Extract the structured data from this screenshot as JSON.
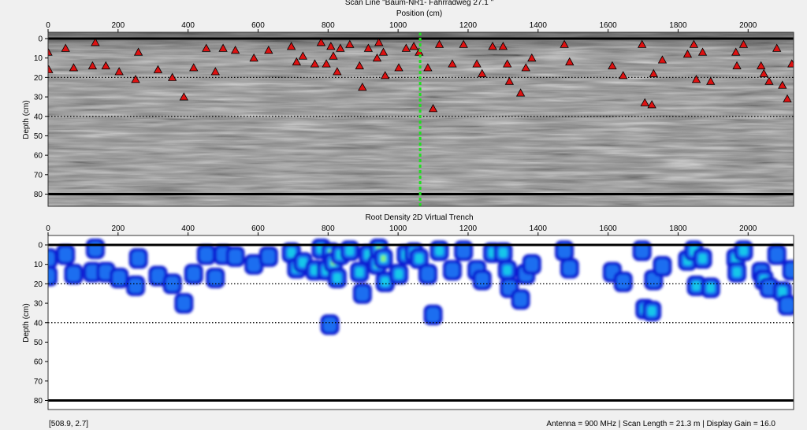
{
  "top_title_line1": "Scan Line \"Baum-NR1- Fahrradweg 27.1 \"",
  "status": {
    "coords": "[508.9, 2.7]",
    "info": "Antenna = 900 MHz | Scan Length = 21.3 m | Display Gain = 16.0"
  },
  "colors": {
    "background": "#f0f0f0",
    "marker_fill": "#dd1111",
    "cursor_line": "#22dd22",
    "depth_line": "#000000"
  },
  "chart_data": [
    {
      "type": "scatter",
      "title": "Position (cm)",
      "xlabel": "",
      "ylabel": "Depth (cm)",
      "xlim": [
        0,
        2130
      ],
      "ylim": [
        0,
        85
      ],
      "y_inverted": true,
      "x_axis_position": "top",
      "x_ticks": [
        0,
        200,
        400,
        600,
        800,
        1000,
        1200,
        1400,
        1600,
        1800,
        2000
      ],
      "y_ticks": [
        0,
        10,
        20,
        30,
        40,
        50,
        60,
        70,
        80
      ],
      "background": "greyscale radargram",
      "reference_lines": {
        "dotted_depths": [
          20,
          40
        ],
        "solid_depths": [
          0,
          80
        ]
      },
      "cursor_position": 1063,
      "marker": "red triangle",
      "points": [
        {
          "x": 0,
          "y": 7
        },
        {
          "x": 2,
          "y": 16
        },
        {
          "x": 50,
          "y": 5
        },
        {
          "x": 73,
          "y": 15
        },
        {
          "x": 127,
          "y": 14
        },
        {
          "x": 135,
          "y": 2
        },
        {
          "x": 165,
          "y": 14
        },
        {
          "x": 203,
          "y": 17
        },
        {
          "x": 250,
          "y": 21
        },
        {
          "x": 258,
          "y": 7
        },
        {
          "x": 314,
          "y": 16
        },
        {
          "x": 355,
          "y": 20
        },
        {
          "x": 388,
          "y": 30
        },
        {
          "x": 416,
          "y": 15
        },
        {
          "x": 452,
          "y": 5
        },
        {
          "x": 478,
          "y": 17
        },
        {
          "x": 500,
          "y": 5
        },
        {
          "x": 535,
          "y": 6
        },
        {
          "x": 588,
          "y": 10
        },
        {
          "x": 630,
          "y": 6
        },
        {
          "x": 695,
          "y": 4
        },
        {
          "x": 710,
          "y": 12
        },
        {
          "x": 728,
          "y": 9
        },
        {
          "x": 762,
          "y": 13
        },
        {
          "x": 780,
          "y": 2
        },
        {
          "x": 795,
          "y": 13
        },
        {
          "x": 808,
          "y": 4
        },
        {
          "x": 815,
          "y": 9
        },
        {
          "x": 826,
          "y": 17
        },
        {
          "x": 835,
          "y": 5
        },
        {
          "x": 862,
          "y": 3
        },
        {
          "x": 890,
          "y": 14
        },
        {
          "x": 898,
          "y": 25
        },
        {
          "x": 915,
          "y": 5
        },
        {
          "x": 940,
          "y": 10
        },
        {
          "x": 945,
          "y": 2
        },
        {
          "x": 958,
          "y": 7
        },
        {
          "x": 963,
          "y": 19
        },
        {
          "x": 1002,
          "y": 15
        },
        {
          "x": 1023,
          "y": 5
        },
        {
          "x": 1045,
          "y": 4
        },
        {
          "x": 1060,
          "y": 7
        },
        {
          "x": 1085,
          "y": 15
        },
        {
          "x": 1100,
          "y": 36
        },
        {
          "x": 1118,
          "y": 3
        },
        {
          "x": 1155,
          "y": 13
        },
        {
          "x": 1187,
          "y": 3
        },
        {
          "x": 1225,
          "y": 13
        },
        {
          "x": 1240,
          "y": 18
        },
        {
          "x": 1270,
          "y": 4
        },
        {
          "x": 1300,
          "y": 4
        },
        {
          "x": 1312,
          "y": 13
        },
        {
          "x": 1318,
          "y": 22
        },
        {
          "x": 1350,
          "y": 28
        },
        {
          "x": 1365,
          "y": 15
        },
        {
          "x": 1382,
          "y": 10
        },
        {
          "x": 1475,
          "y": 3
        },
        {
          "x": 1490,
          "y": 12
        },
        {
          "x": 1612,
          "y": 14
        },
        {
          "x": 1643,
          "y": 19
        },
        {
          "x": 1697,
          "y": 3
        },
        {
          "x": 1705,
          "y": 33
        },
        {
          "x": 1725,
          "y": 34
        },
        {
          "x": 1730,
          "y": 18
        },
        {
          "x": 1755,
          "y": 11
        },
        {
          "x": 1827,
          "y": 8
        },
        {
          "x": 1845,
          "y": 3
        },
        {
          "x": 1852,
          "y": 21
        },
        {
          "x": 1870,
          "y": 7
        },
        {
          "x": 1893,
          "y": 22
        },
        {
          "x": 1965,
          "y": 7
        },
        {
          "x": 1968,
          "y": 14
        },
        {
          "x": 1987,
          "y": 3
        },
        {
          "x": 2037,
          "y": 14
        },
        {
          "x": 2045,
          "y": 18
        },
        {
          "x": 2060,
          "y": 22
        },
        {
          "x": 2082,
          "y": 5
        },
        {
          "x": 2098,
          "y": 24
        },
        {
          "x": 2112,
          "y": 31
        },
        {
          "x": 2125,
          "y": 13
        }
      ]
    },
    {
      "type": "heatmap",
      "title": "Root Density 2D Virtual Trench",
      "xlabel": "",
      "ylabel": "Depth (cm)",
      "xlim": [
        0,
        2130
      ],
      "ylim": [
        0,
        85
      ],
      "y_inverted": true,
      "x_axis_position": "top",
      "x_ticks": [
        0,
        200,
        400,
        600,
        800,
        1000,
        1200,
        1400,
        1600,
        1800,
        2000
      ],
      "y_ticks": [
        0,
        10,
        20,
        30,
        40,
        50,
        60,
        70,
        80
      ],
      "reference_lines": {
        "dotted_depths": [
          20,
          40
        ],
        "solid_depths": [
          0,
          80
        ]
      },
      "colormap": [
        "#0a1ed2",
        "#1a6ef0",
        "#18c6ea",
        "#82f082"
      ],
      "cell_value_scale": "0-1 relative density",
      "cells": [
        [
          0,
          7,
          0.2
        ],
        [
          50,
          5,
          0.2
        ],
        [
          0,
          16,
          0.2
        ],
        [
          73,
          15,
          0.2
        ],
        [
          127,
          14,
          0.25
        ],
        [
          135,
          2,
          0.2
        ],
        [
          165,
          14,
          0.25
        ],
        [
          203,
          17,
          0.2
        ],
        [
          258,
          7,
          0.2
        ],
        [
          250,
          21,
          0.2
        ],
        [
          314,
          16,
          0.2
        ],
        [
          355,
          20,
          0.2
        ],
        [
          388,
          30,
          0.2
        ],
        [
          416,
          15,
          0.2
        ],
        [
          452,
          5,
          0.25
        ],
        [
          478,
          17,
          0.2
        ],
        [
          500,
          5,
          0.3
        ],
        [
          535,
          6,
          0.3
        ],
        [
          588,
          10,
          0.25
        ],
        [
          630,
          6,
          0.25
        ],
        [
          695,
          4,
          0.4
        ],
        [
          710,
          12,
          0.45
        ],
        [
          728,
          9,
          0.55
        ],
        [
          762,
          13,
          0.45
        ],
        [
          780,
          2,
          0.45
        ],
        [
          795,
          13,
          0.5
        ],
        [
          808,
          4,
          0.65
        ],
        [
          815,
          9,
          0.6
        ],
        [
          826,
          17,
          0.45
        ],
        [
          835,
          5,
          0.5
        ],
        [
          805,
          41,
          0.25
        ],
        [
          862,
          3,
          0.55
        ],
        [
          890,
          14,
          0.5
        ],
        [
          898,
          25,
          0.3
        ],
        [
          915,
          5,
          0.55
        ],
        [
          940,
          10,
          0.75
        ],
        [
          945,
          2,
          0.6
        ],
        [
          958,
          7,
          0.6
        ],
        [
          963,
          19,
          0.45
        ],
        [
          1002,
          15,
          0.45
        ],
        [
          1023,
          5,
          0.55
        ],
        [
          1045,
          4,
          0.7
        ],
        [
          1060,
          7,
          0.5
        ],
        [
          1085,
          15,
          0.3
        ],
        [
          1100,
          36,
          0.3
        ],
        [
          1118,
          3,
          0.35
        ],
        [
          1155,
          13,
          0.3
        ],
        [
          1187,
          3,
          0.3
        ],
        [
          1225,
          13,
          0.3
        ],
        [
          1240,
          18,
          0.3
        ],
        [
          1270,
          4,
          0.35
        ],
        [
          1300,
          4,
          0.4
        ],
        [
          1312,
          13,
          0.35
        ],
        [
          1318,
          22,
          0.3
        ],
        [
          1350,
          28,
          0.3
        ],
        [
          1365,
          15,
          0.3
        ],
        [
          1382,
          10,
          0.3
        ],
        [
          1475,
          3,
          0.3
        ],
        [
          1490,
          12,
          0.3
        ],
        [
          1612,
          14,
          0.3
        ],
        [
          1643,
          19,
          0.3
        ],
        [
          1697,
          3,
          0.3
        ],
        [
          1705,
          33,
          0.4
        ],
        [
          1725,
          34,
          0.5
        ],
        [
          1730,
          18,
          0.3
        ],
        [
          1755,
          11,
          0.3
        ],
        [
          1827,
          8,
          0.45
        ],
        [
          1845,
          3,
          0.5
        ],
        [
          1852,
          21,
          0.35
        ],
        [
          1870,
          7,
          0.35
        ],
        [
          1893,
          22,
          0.35
        ],
        [
          1965,
          7,
          0.45
        ],
        [
          1968,
          14,
          0.4
        ],
        [
          1987,
          3,
          0.4
        ],
        [
          2037,
          14,
          0.3
        ],
        [
          2045,
          18,
          0.35
        ],
        [
          2060,
          22,
          0.3
        ],
        [
          2082,
          5,
          0.3
        ],
        [
          2098,
          24,
          0.35
        ],
        [
          2112,
          31,
          0.3
        ],
        [
          2125,
          13,
          0.3
        ]
      ]
    }
  ]
}
